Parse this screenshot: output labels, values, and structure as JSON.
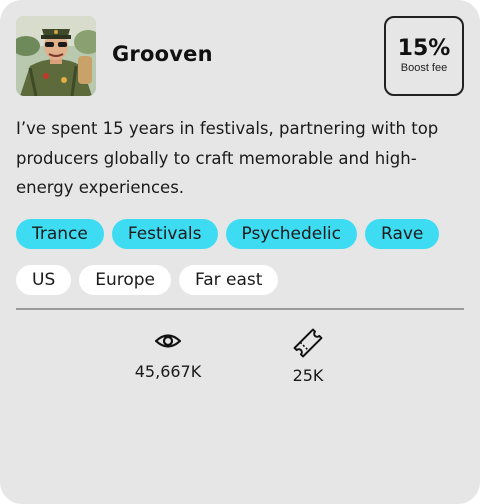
{
  "profile": {
    "name": "Grooven",
    "avatar_icon": "person-in-military-cap-with-sunglasses",
    "boost": {
      "value": "15%",
      "label": "Boost fee"
    },
    "bio": "I’ve spent 15 years in festivals, partnering with top producers globally to craft memorable and high-energy experiences."
  },
  "genres": [
    "Trance",
    "Festivals",
    "Psychedelic",
    "Rave"
  ],
  "regions": [
    "US",
    "Europe",
    "Far east"
  ],
  "stats": {
    "views": {
      "icon": "eye-icon",
      "value": "45,667K"
    },
    "tickets": {
      "icon": "ticket-icon",
      "value": "25K"
    }
  },
  "colors": {
    "card_background": "#e6e6e6",
    "genre_chip": "#3ddcf2",
    "region_chip": "#ffffff",
    "divider": "#9a9a9a"
  }
}
